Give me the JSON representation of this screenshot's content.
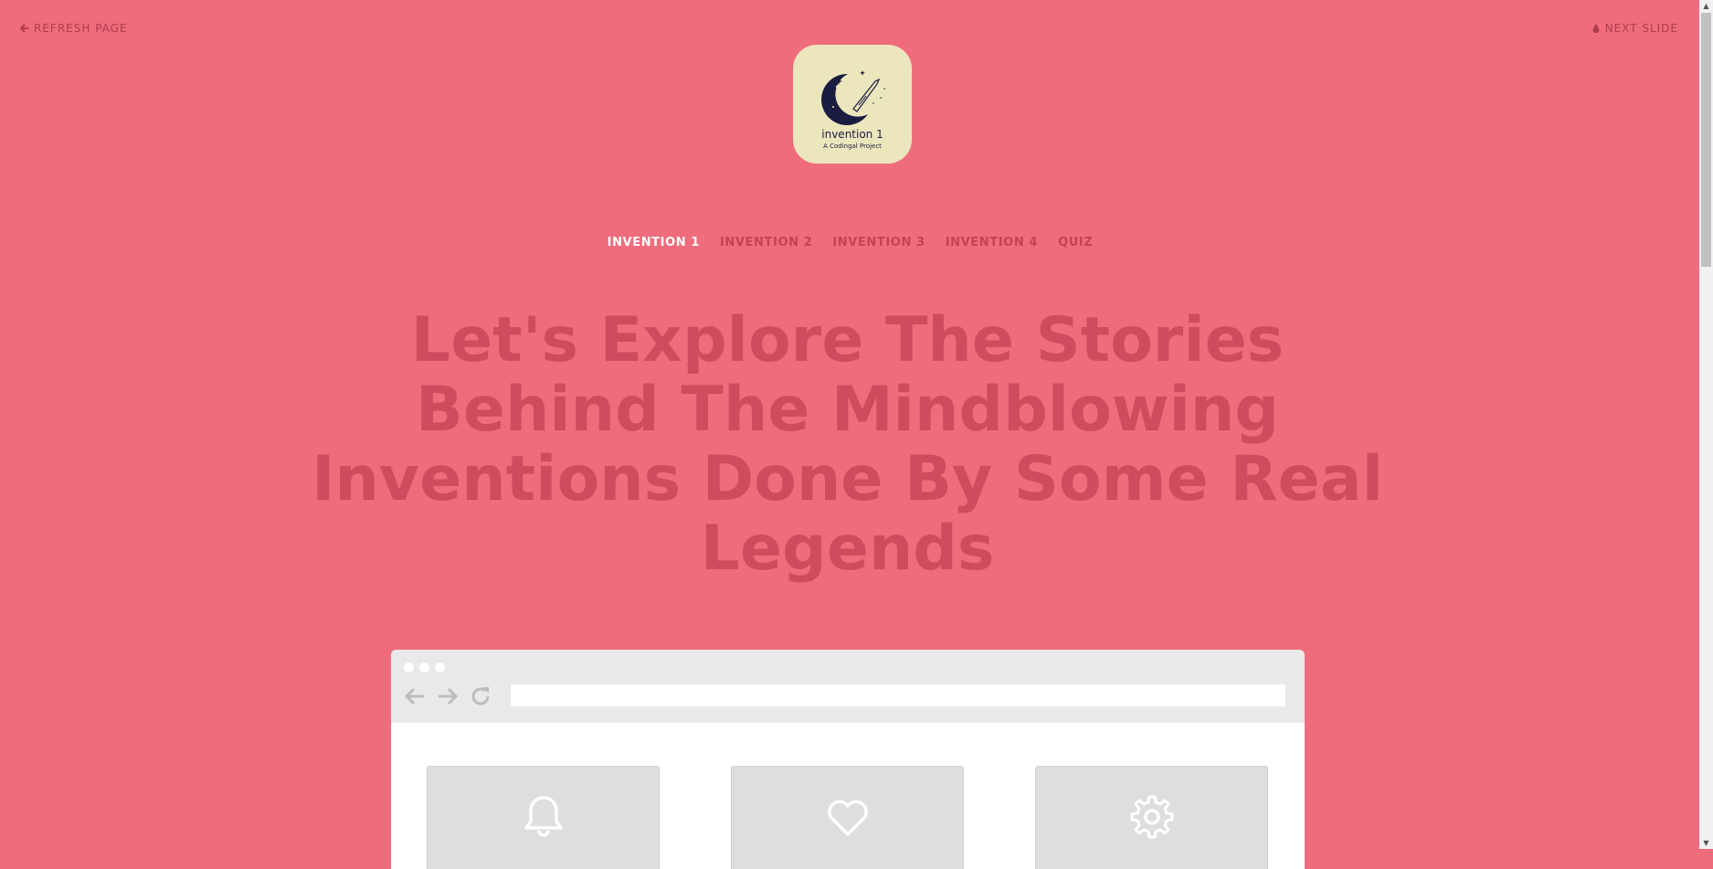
{
  "header": {
    "refresh_label": "REFRESH PAGE",
    "next_label": "NEXT SLIDE"
  },
  "logo": {
    "title": "invention 1",
    "subtitle": "A Codingal Project"
  },
  "nav": {
    "items": [
      {
        "label": "INVENTION 1",
        "active": true
      },
      {
        "label": "INVENTION 2",
        "active": false
      },
      {
        "label": "INVENTION 3",
        "active": false
      },
      {
        "label": "INVENTION 4",
        "active": false
      },
      {
        "label": "QUIZ",
        "active": false
      }
    ]
  },
  "hero": {
    "headline": "Let's Explore The Stories Behind The Mindblowing Inventions Done By Some Real Legends"
  },
  "browser_mock": {
    "url": "",
    "cards": [
      {
        "icon": "bell-icon"
      },
      {
        "icon": "heart-icon"
      },
      {
        "icon": "gear-icon"
      }
    ]
  },
  "colors": {
    "background": "#ef6c7d",
    "headline": "#cf4c5e",
    "nav_inactive": "#c14455",
    "nav_active": "#ffffff",
    "logo_bg": "#ece6bd"
  }
}
